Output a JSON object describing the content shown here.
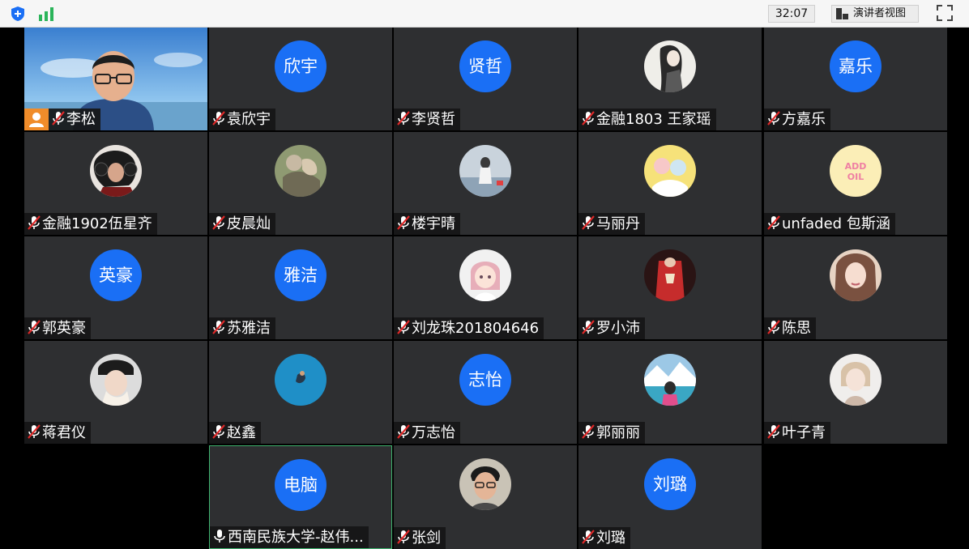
{
  "toolbar": {
    "timer": "32:07",
    "speaker_view_label": "演讲者视图",
    "icons": [
      "shield-plus-icon",
      "signal-icon",
      "speaker-view-icon",
      "fullscreen-icon"
    ],
    "colors": {
      "shield": "#1a6ff5",
      "signal": "#2bb45a"
    }
  },
  "participants": [
    {
      "name": "李松",
      "tile": "video",
      "role": "host",
      "muted": true
    },
    {
      "name": "袁欣宇",
      "initials": "欣宇",
      "tile": "initials",
      "muted": true
    },
    {
      "name": "李贤哲",
      "initials": "贤哲",
      "tile": "initials",
      "muted": true
    },
    {
      "name": "金融1803 王家瑶",
      "tile": "avatar",
      "avatar": "ink-portrait",
      "muted": true
    },
    {
      "name": "方嘉乐",
      "initials": "嘉乐",
      "tile": "initials",
      "muted": true
    },
    {
      "name": "金融1902伍星齐",
      "tile": "avatar",
      "avatar": "person-headphones",
      "muted": true
    },
    {
      "name": "皮晨灿",
      "tile": "avatar",
      "avatar": "painting",
      "muted": true
    },
    {
      "name": "楼宇晴",
      "tile": "avatar",
      "avatar": "girl-sky",
      "muted": true
    },
    {
      "name": "马丽丹",
      "tile": "avatar",
      "avatar": "cartoon-yellow",
      "muted": true
    },
    {
      "name": "unfaded 包斯涵",
      "tile": "avatar",
      "avatar": "add-oil",
      "avatar_text": "ADD OIL",
      "muted": true
    },
    {
      "name": "郭英豪",
      "initials": "英豪",
      "tile": "initials",
      "muted": true
    },
    {
      "name": "苏雅洁",
      "initials": "雅洁",
      "tile": "initials",
      "muted": true
    },
    {
      "name": "刘龙珠201804646",
      "tile": "avatar",
      "avatar": "anime-girl",
      "muted": true
    },
    {
      "name": "罗小沛",
      "tile": "avatar",
      "avatar": "red-costume",
      "muted": true
    },
    {
      "name": "陈思",
      "tile": "avatar",
      "avatar": "woman-portrait",
      "muted": true
    },
    {
      "name": "蒋君仪",
      "tile": "avatar",
      "avatar": "girl-cap",
      "muted": true
    },
    {
      "name": "赵鑫",
      "tile": "avatar",
      "avatar": "swimmer-blue",
      "muted": true
    },
    {
      "name": "万志怡",
      "initials": "志怡",
      "tile": "initials",
      "muted": true
    },
    {
      "name": "郭丽丽",
      "tile": "avatar",
      "avatar": "mountain-lake",
      "muted": true
    },
    {
      "name": "叶子青",
      "tile": "avatar",
      "avatar": "light-portrait",
      "muted": true
    },
    {
      "name": "西南民族大学-赵伟...",
      "initials": "电脑",
      "tile": "initials",
      "muted": false,
      "active_speaker": true
    },
    {
      "name": "张剑",
      "tile": "avatar",
      "avatar": "man-glasses",
      "muted": true
    },
    {
      "name": "刘璐",
      "initials": "刘璐",
      "tile": "initials",
      "muted": true
    }
  ],
  "colors": {
    "tile_bg": "#2e2f31",
    "initials_bg": "#1a6ff5",
    "active_border": "#3eb26e",
    "host_badge": "#f08c2a",
    "muted_slash": "#e02828"
  }
}
